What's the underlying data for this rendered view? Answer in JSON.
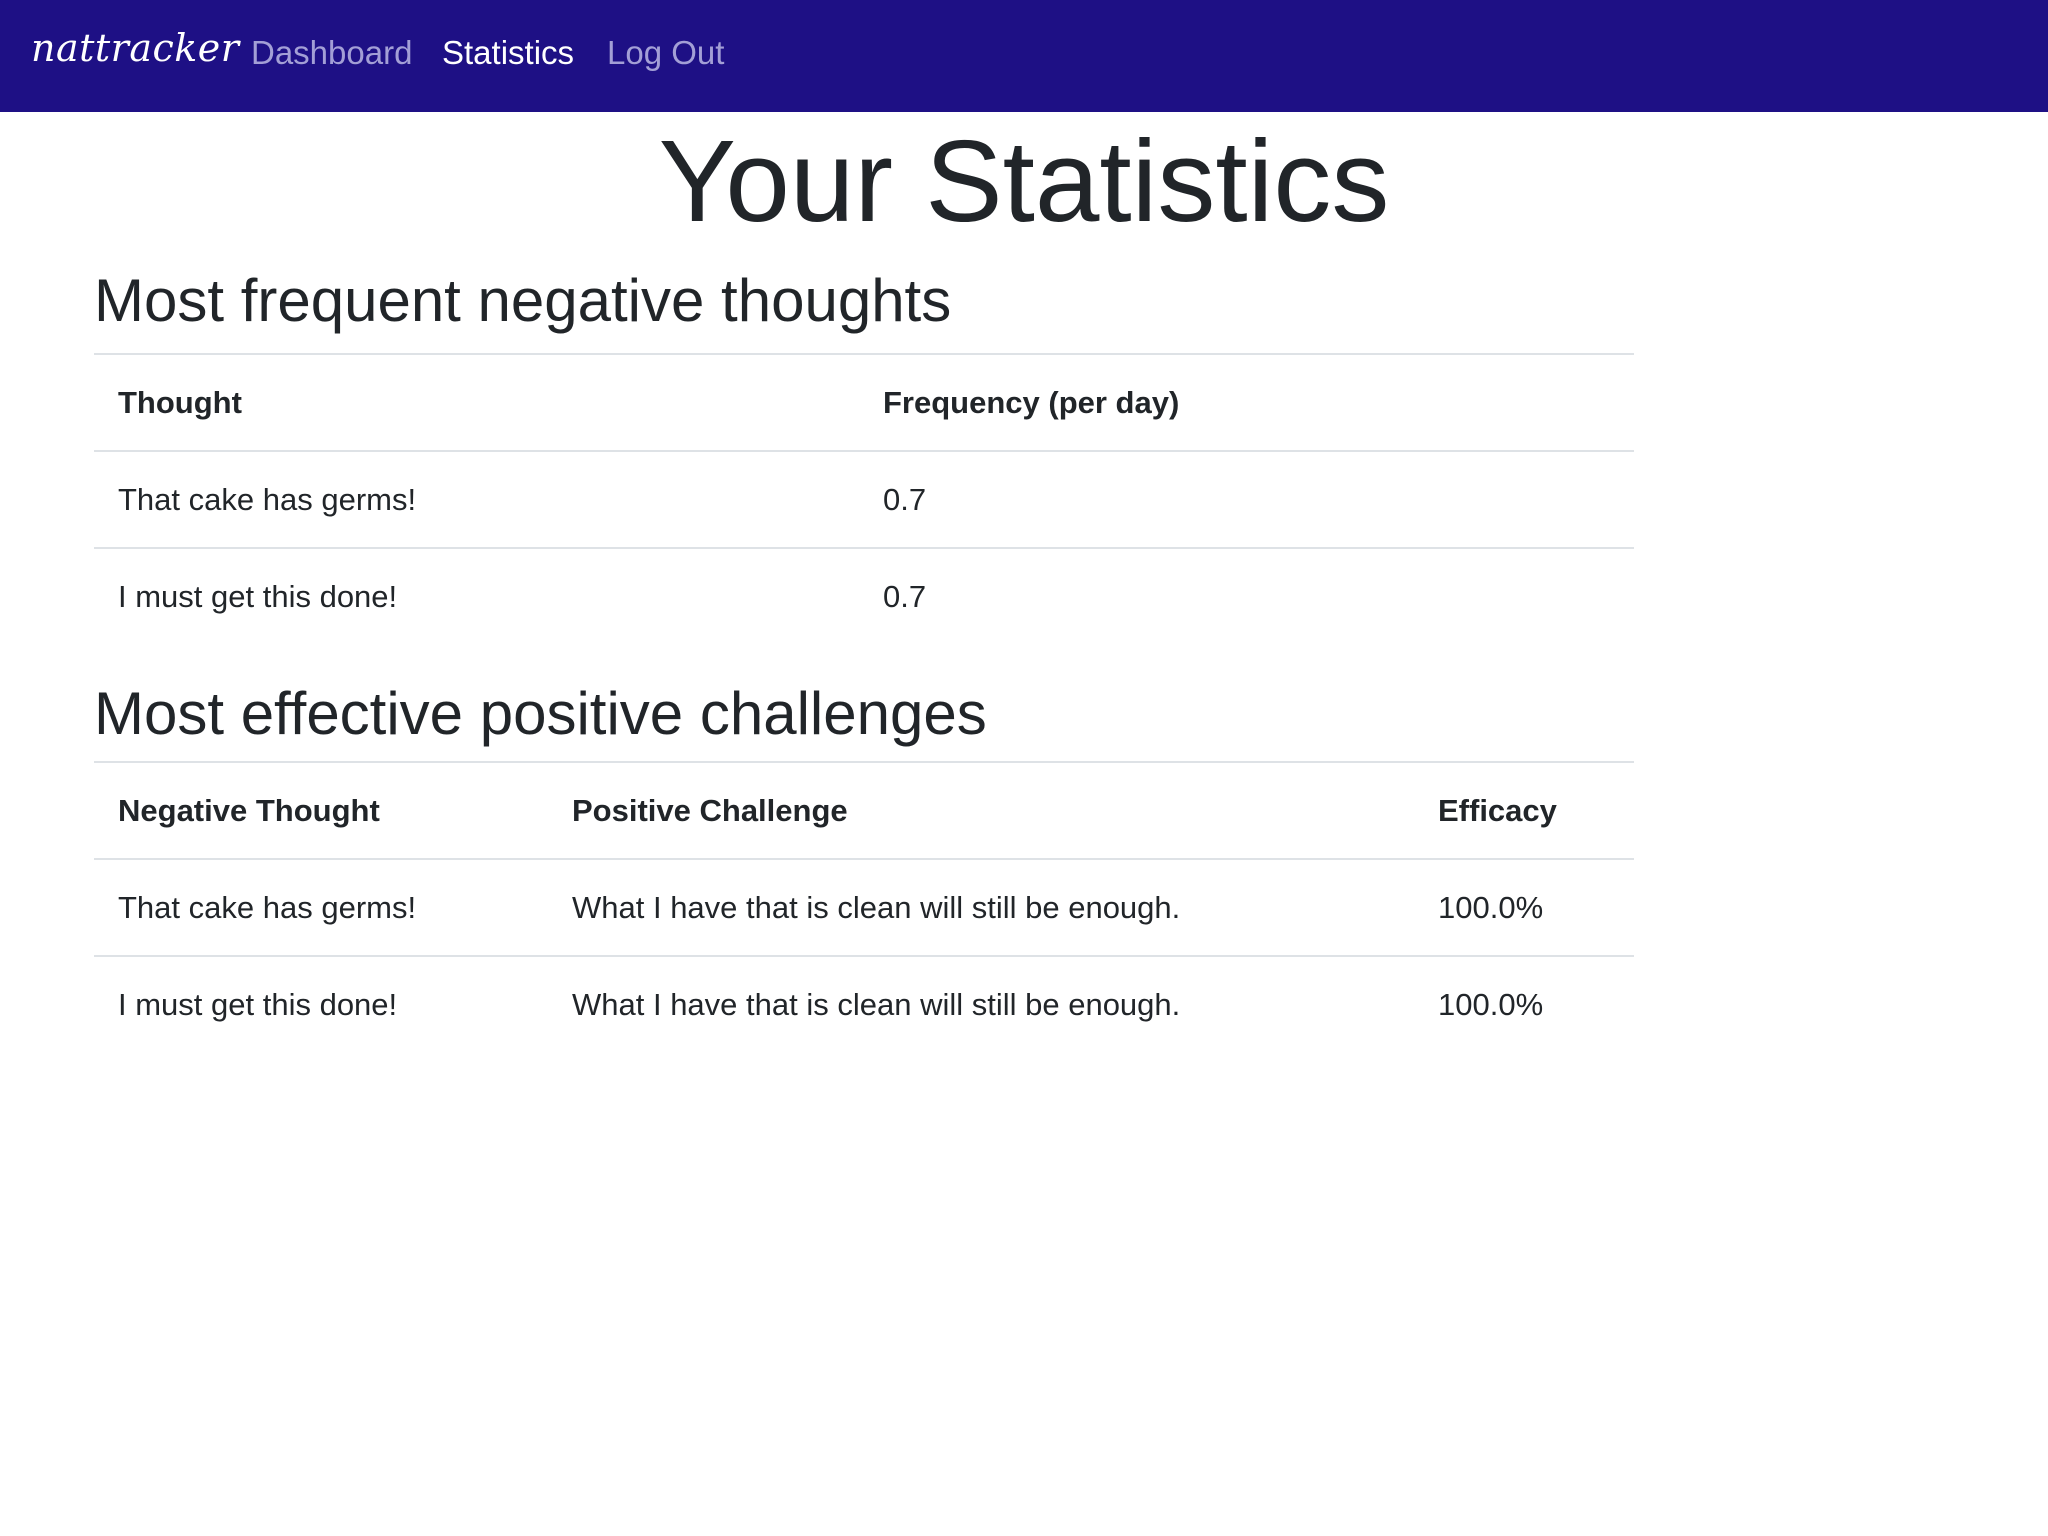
{
  "navbar": {
    "brand": "nattracker",
    "links": [
      {
        "label": "Dashboard",
        "active": false
      },
      {
        "label": "Statistics",
        "active": true
      },
      {
        "label": "Log Out",
        "active": false
      }
    ],
    "background_color": "#1e1085"
  },
  "page": {
    "title": "Your Statistics"
  },
  "negative_thoughts": {
    "title": "Most frequent negative thoughts",
    "headers": [
      "Thought",
      "Frequency (per day)"
    ],
    "rows": [
      [
        "That cake has germs!",
        "0.7"
      ],
      [
        "I must get this done!",
        "0.7"
      ]
    ]
  },
  "positive_challenges": {
    "title": "Most effective positive challenges",
    "headers": [
      "Negative Thought",
      "Positive Challenge",
      "Efficacy"
    ],
    "rows": [
      [
        "That cake has germs!",
        "What I have that is clean will still be enough.",
        "100.0%"
      ],
      [
        "I must get this done!",
        "What I have that is clean will still be enough.",
        "100.0%"
      ]
    ]
  }
}
